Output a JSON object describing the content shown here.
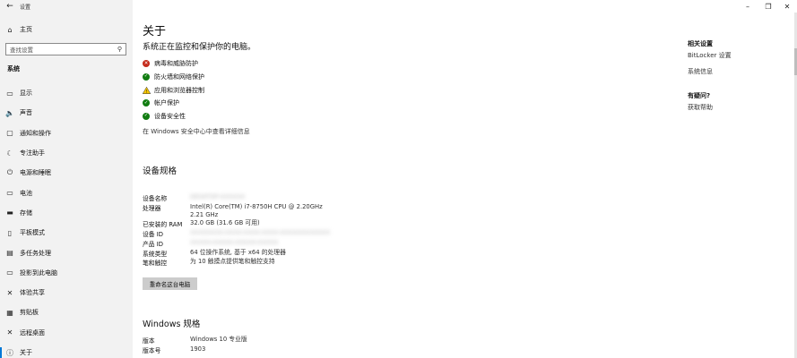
{
  "window": {
    "title": "设置",
    "controls": {
      "minimize": "–",
      "maximize": "❐",
      "close": "✕"
    }
  },
  "sidebar": {
    "home_label": "主页",
    "search_placeholder": "查找设置",
    "section_title": "系统",
    "items": [
      {
        "label": "显示",
        "icon": "monitor-icon",
        "glyph": "▭"
      },
      {
        "label": "声音",
        "icon": "speaker-icon",
        "glyph": "🔈"
      },
      {
        "label": "通知和操作",
        "icon": "notification-icon",
        "glyph": "▢"
      },
      {
        "label": "专注助手",
        "icon": "moon-icon",
        "glyph": "☾"
      },
      {
        "label": "电源和睡眠",
        "icon": "power-icon",
        "glyph": "⏻"
      },
      {
        "label": "电池",
        "icon": "battery-icon",
        "glyph": "▭"
      },
      {
        "label": "存储",
        "icon": "storage-icon",
        "glyph": "▬"
      },
      {
        "label": "平板模式",
        "icon": "tablet-icon",
        "glyph": "▯"
      },
      {
        "label": "多任务处理",
        "icon": "multitask-icon",
        "glyph": "▤"
      },
      {
        "label": "投影到此电脑",
        "icon": "projector-icon",
        "glyph": "▭"
      },
      {
        "label": "体验共享",
        "icon": "share-icon",
        "glyph": "✕"
      },
      {
        "label": "剪贴板",
        "icon": "clipboard-icon",
        "glyph": "▦"
      },
      {
        "label": "远程桌面",
        "icon": "remote-icon",
        "glyph": "✕"
      },
      {
        "label": "关于",
        "icon": "info-icon",
        "glyph": "ⓘ"
      }
    ]
  },
  "main": {
    "title": "关于",
    "monitor_text": "系统正在监控和保护你的电脑。",
    "status": [
      {
        "label": "病毒和威胁防护",
        "state": "error",
        "glyph": "✕"
      },
      {
        "label": "防火墙和网络保护",
        "state": "ok",
        "glyph": "✓"
      },
      {
        "label": "应用和浏览器控制",
        "state": "warning",
        "glyph": "!"
      },
      {
        "label": "帐户保护",
        "state": "ok",
        "glyph": "✓"
      },
      {
        "label": "设备安全性",
        "state": "ok",
        "glyph": "✓"
      }
    ],
    "detail_link": "在 Windows 安全中心中查看详细信息",
    "device_spec": {
      "heading": "设备规格",
      "rows": [
        {
          "label": "设备名称",
          "value": "DESKTOP-XXXXXX",
          "blurred": true
        },
        {
          "label": "处理器",
          "value": "Intel(R) Core(TM) i7-8750H CPU @ 2.20GHz 2.21 GHz",
          "blurred": false
        },
        {
          "label": "已安装的 RAM",
          "value": "32.0 GB (31.6 GB 可用)",
          "blurred": false
        },
        {
          "label": "设备 ID",
          "value": "XXXXXXXX-XXXX-XXXX-XXXX-XXXXXXXXXXXX",
          "blurred": true
        },
        {
          "label": "产品 ID",
          "value": "XXXXX-XXXXX-XXXXX-XXXXX",
          "blurred": true
        },
        {
          "label": "系统类型",
          "value": "64 位操作系统, 基于 x64 的处理器",
          "blurred": false
        },
        {
          "label": "笔和触控",
          "value": "为 10 触摸点提供笔和触控支持",
          "blurred": false
        }
      ],
      "rename_button": "重命名这台电脑"
    },
    "windows_spec": {
      "heading": "Windows 规格",
      "rows": [
        {
          "label": "版本",
          "value": "Windows 10 专业版"
        },
        {
          "label": "版本号",
          "value": "1903"
        }
      ]
    }
  },
  "right": {
    "related_title": "相关设置",
    "bitlocker": "BitLocker 设置",
    "system_info": "系统信息",
    "question_title": "有疑问?",
    "get_help": "获取帮助"
  },
  "colors": {
    "accent": "#0078d7",
    "error": "#c42b1c",
    "ok": "#107c10",
    "warning": "#f7c600"
  }
}
